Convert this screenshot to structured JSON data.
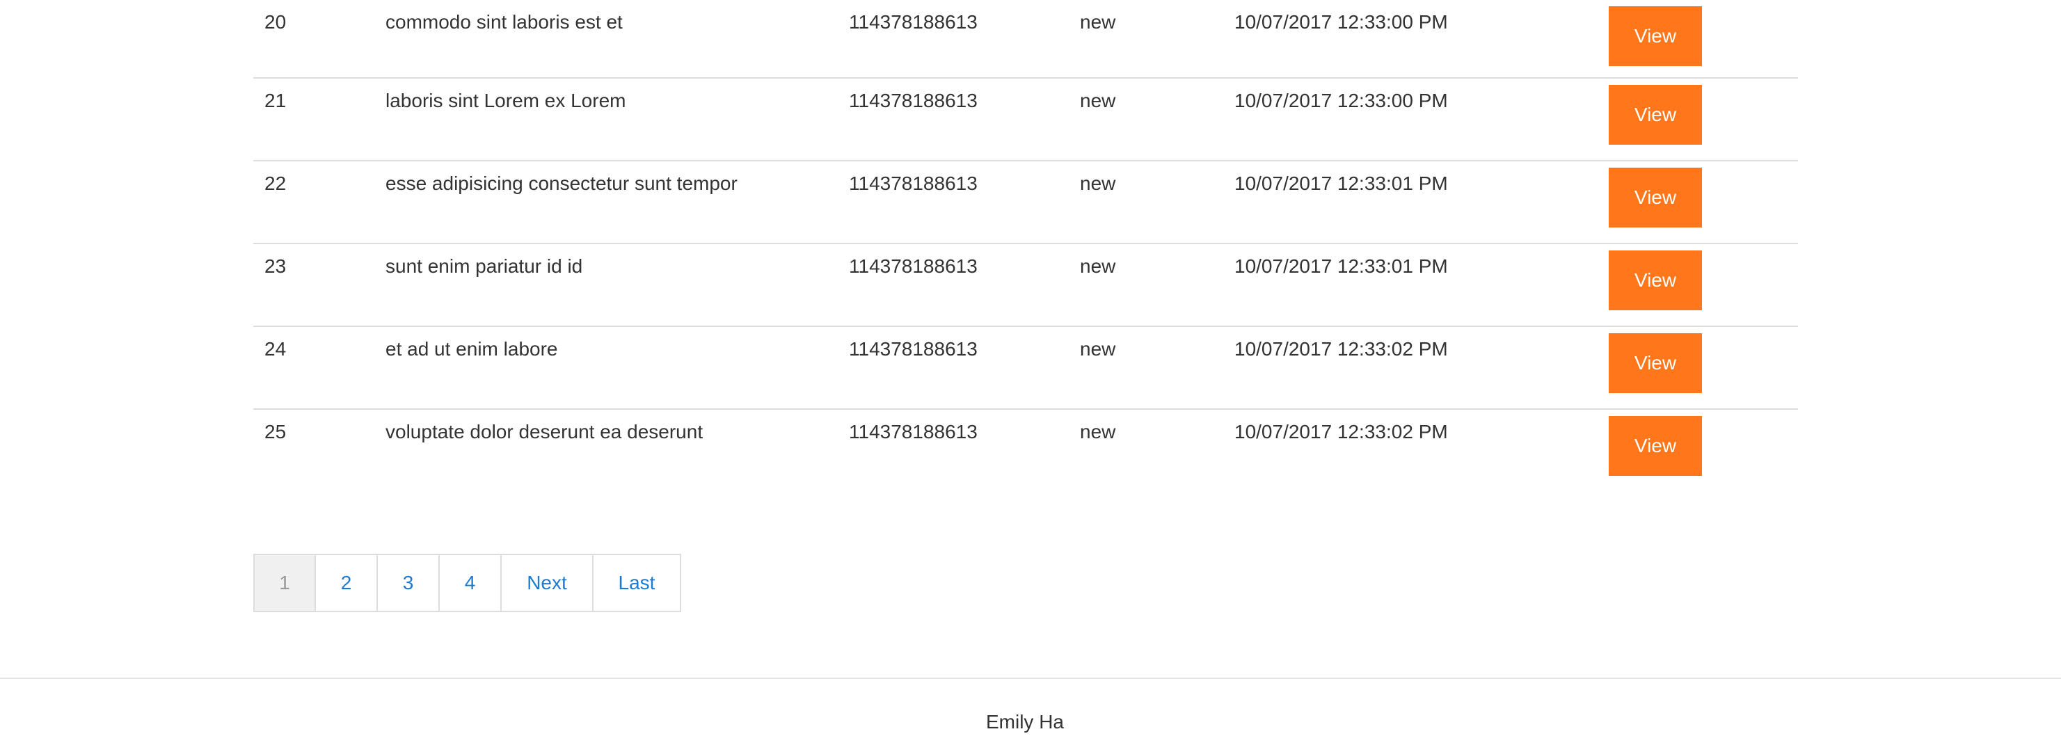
{
  "table": {
    "rows": [
      {
        "id": "20",
        "title": "commodo sint laboris est et",
        "number": "114378188613",
        "status": "new",
        "date": "10/07/2017 12:33:00 PM",
        "action": "View"
      },
      {
        "id": "21",
        "title": "laboris sint Lorem ex Lorem",
        "number": "114378188613",
        "status": "new",
        "date": "10/07/2017 12:33:00 PM",
        "action": "View"
      },
      {
        "id": "22",
        "title": "esse adipisicing consectetur sunt tempor",
        "number": "114378188613",
        "status": "new",
        "date": "10/07/2017 12:33:01 PM",
        "action": "View"
      },
      {
        "id": "23",
        "title": "sunt enim pariatur id id",
        "number": "114378188613",
        "status": "new",
        "date": "10/07/2017 12:33:01 PM",
        "action": "View"
      },
      {
        "id": "24",
        "title": "et ad ut enim labore",
        "number": "114378188613",
        "status": "new",
        "date": "10/07/2017 12:33:02 PM",
        "action": "View"
      },
      {
        "id": "25",
        "title": "voluptate dolor deserunt ea deserunt",
        "number": "114378188613",
        "status": "new",
        "date": "10/07/2017 12:33:02 PM",
        "action": "View"
      }
    ]
  },
  "pagination": {
    "items": [
      {
        "label": "1",
        "active": true
      },
      {
        "label": "2",
        "active": false
      },
      {
        "label": "3",
        "active": false
      },
      {
        "label": "4",
        "active": false
      },
      {
        "label": "Next",
        "active": false
      },
      {
        "label": "Last",
        "active": false
      }
    ]
  },
  "footer": {
    "text": "Emily Ha"
  },
  "colors": {
    "button_bg": "#ff761b",
    "link": "#1e7ad1",
    "active_page_bg": "#f0f0f0"
  }
}
